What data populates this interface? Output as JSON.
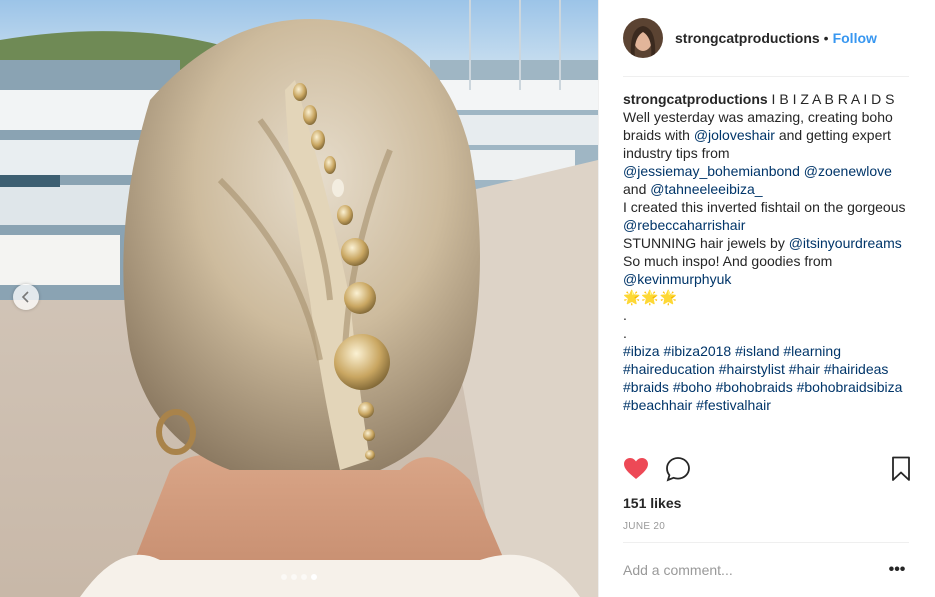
{
  "photo": {
    "description_icon": "prev-chevron-icon",
    "carousel": {
      "count": 4,
      "active": 4
    }
  },
  "header": {
    "username": "strongcatproductions",
    "separator": "•",
    "follow_label": "Follow"
  },
  "caption": {
    "username": "strongcatproductions",
    "line1": " I B I Z A B R A I D S",
    "t1": "Well yesterday was amazing, creating boho braids with ",
    "m1": "@joloveshair",
    "t2": " and getting expert industry tips from ",
    "m2": "@jessiemay_bohemianbond",
    "t3": " ",
    "m3": "@zoenewlove",
    "t4": " and ",
    "m4": "@tahneeleeibiza_",
    "t5": "I created this inverted fishtail on the gorgeous ",
    "m5": "@rebeccaharrishair",
    "t6": "STUNNING hair jewels by ",
    "m6": "@itsinyourdreams",
    "t7": "So much inspo! And goodies from ",
    "m7": "@kevinmurphyuk",
    "emojis": "🌟🌟🌟",
    "dot1": ".",
    "dot2": ".",
    "hashtags": [
      "#ibiza",
      "#ibiza2018",
      "#island",
      "#learning",
      "#haireducation",
      "#hairstylist",
      "#hair",
      "#hairideas",
      "#braids",
      "#boho",
      "#bohobraids",
      "#bohobraidsibiza",
      "#beachhair",
      "#festivalhair"
    ]
  },
  "actions": {
    "like_icon": "heart-icon",
    "comment_icon": "comment-icon",
    "save_icon": "bookmark-icon",
    "like_color": "#ed4956"
  },
  "likes": "151 likes",
  "date": "JUNE 20",
  "comment": {
    "placeholder": "Add a comment...",
    "more": "•••"
  }
}
